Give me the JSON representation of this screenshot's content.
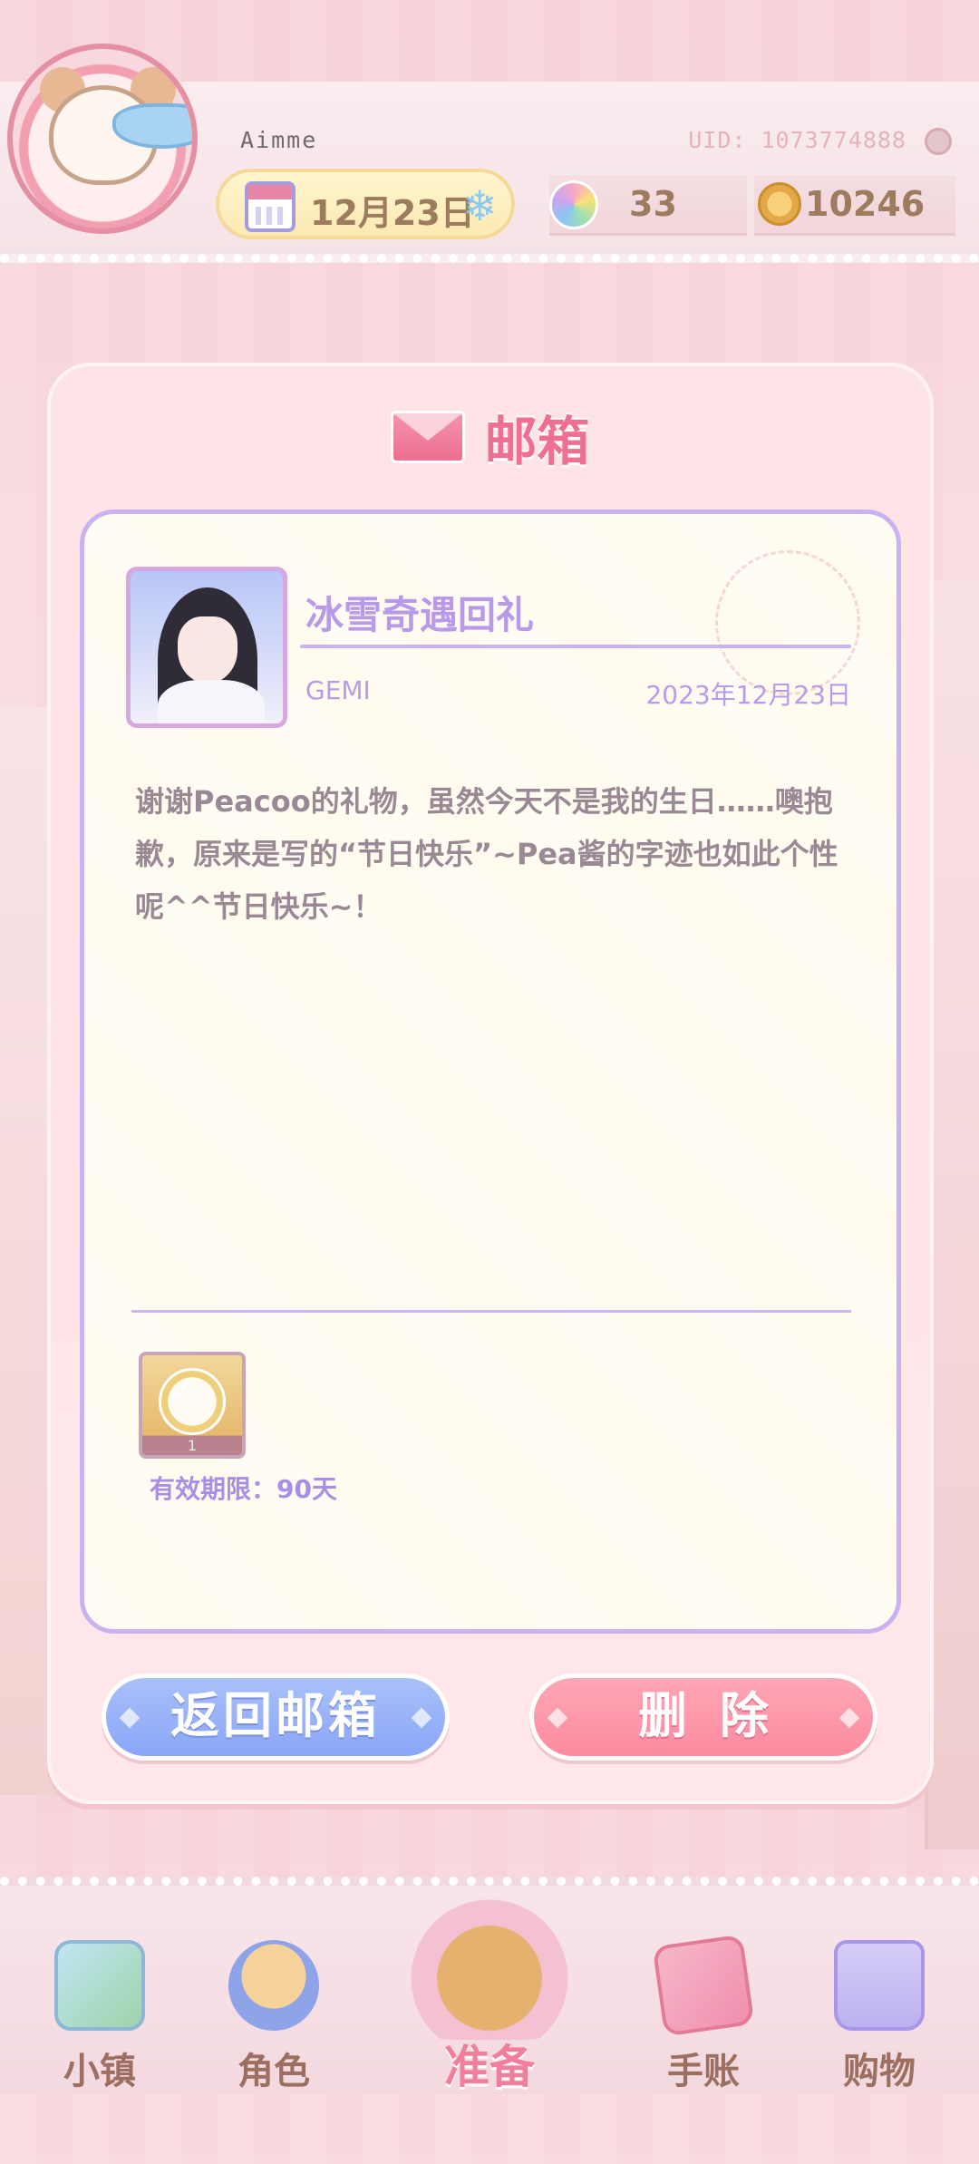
{
  "header": {
    "username": "Aimme",
    "uid": "UID: 1073774888",
    "date": "12月23日",
    "gems": "33",
    "coins": "10246"
  },
  "modal": {
    "title": "邮箱",
    "mail": {
      "subject": "冰雪奇遇回礼",
      "sender": "GEMI",
      "date": "2023年12月23日",
      "body": "谢谢Peacoo的礼物，虽然今天不是我的生日……噢抱歉，原来是写的“节日快乐”~Pea酱的字迹也如此个性呢^^节日快乐~！",
      "reward_count": "1",
      "validity": "有效期限：90天"
    },
    "buttons": {
      "back": "返回邮箱",
      "delete": "删除"
    }
  },
  "bottom_nav": {
    "items": [
      {
        "label": "小镇",
        "icon": "map-icon"
      },
      {
        "label": "角色",
        "icon": "character-icon"
      },
      {
        "label": "准备",
        "icon": "basket-icon"
      },
      {
        "label": "手账",
        "icon": "journal-icon"
      },
      {
        "label": "购物",
        "icon": "shopping-bag-icon"
      }
    ]
  },
  "colors": {
    "accent_pink": "#ee6f90",
    "accent_purple": "#b89ae8",
    "button_blue": "#8aa6f6",
    "button_pink": "#fb8aa0"
  }
}
